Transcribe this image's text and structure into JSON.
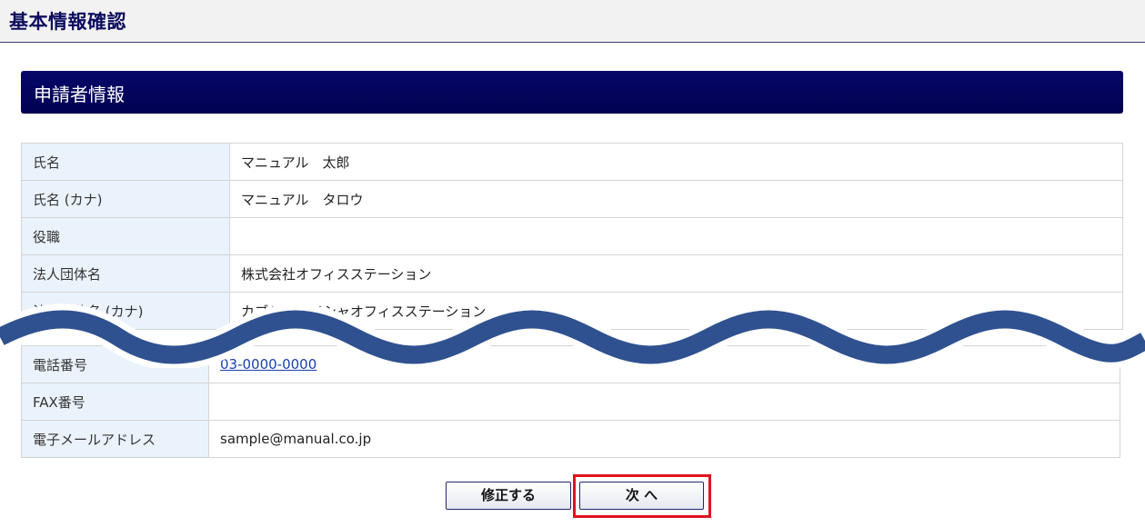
{
  "page": {
    "title": "基本情報確認"
  },
  "section": {
    "title": "申請者情報"
  },
  "fields_top": [
    {
      "label": "氏名",
      "value": "マニュアル　太郎"
    },
    {
      "label": "氏名 (カナ)",
      "value": "マニュアル　タロウ"
    },
    {
      "label": "役職",
      "value": ""
    },
    {
      "label": "法人団体名",
      "value": "株式会社オフィスステーション"
    },
    {
      "label": "法人団体名 (カナ)",
      "value": "カブシキガイシャオフィスステーション"
    }
  ],
  "fields_bottom": [
    {
      "label": "電話番号",
      "value": "03-0000-0000"
    },
    {
      "label": "FAX番号",
      "value": ""
    },
    {
      "label": "電子メールアドレス",
      "value": "sample@manual.co.jp"
    }
  ],
  "buttons": {
    "edit": "修正する",
    "next": "次 へ"
  },
  "colors": {
    "header_bar": "#020250",
    "highlight": "#e1131d",
    "wave": "#2f5190",
    "label_bg": "#eaf3fc"
  }
}
